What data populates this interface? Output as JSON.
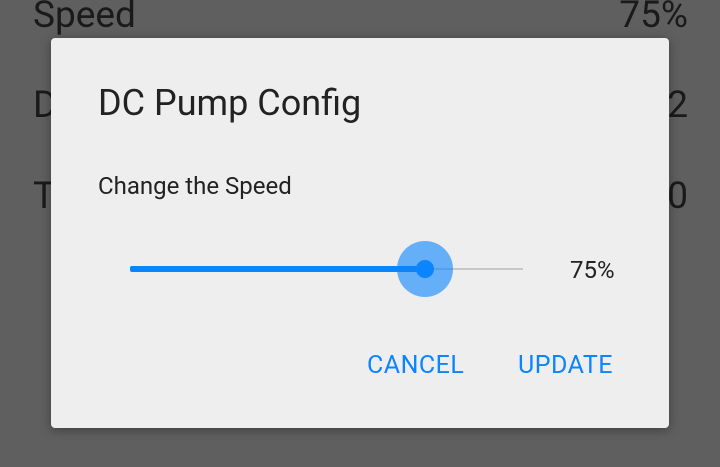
{
  "background_list": {
    "rows": [
      {
        "label": "Speed",
        "value": "75%"
      },
      {
        "label": "D",
        "value": "2"
      },
      {
        "label": "T",
        "value": "0"
      }
    ]
  },
  "dialog": {
    "title": "DC Pump Config",
    "subtitle": "Change the Speed",
    "slider": {
      "value_fraction": 0.75,
      "value_label": "75%",
      "accent_color": "#0a84ff"
    },
    "buttons": {
      "cancel": "CANCEL",
      "update": "UPDATE"
    }
  }
}
